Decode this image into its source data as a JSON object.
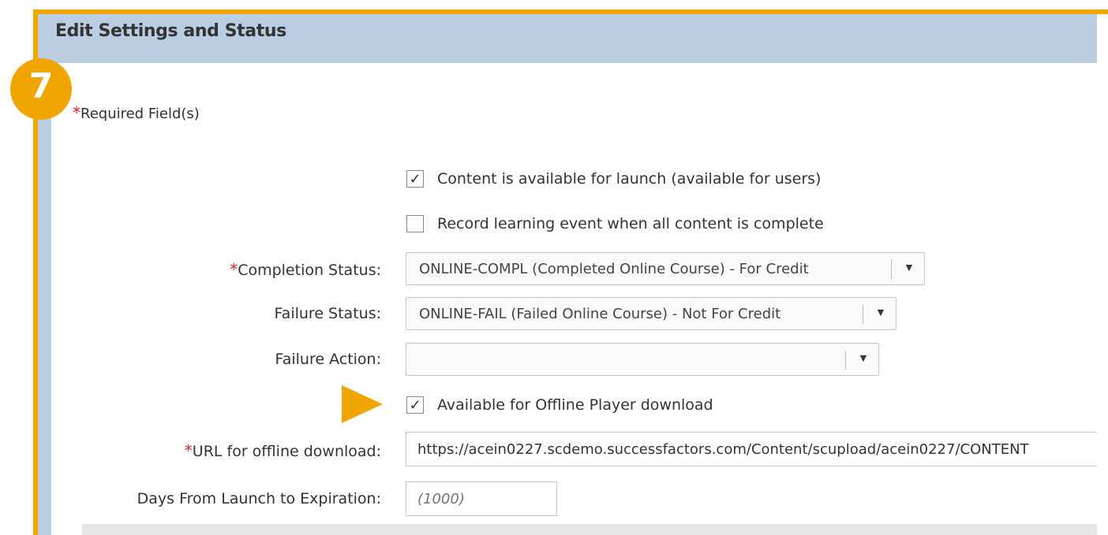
{
  "header": {
    "title": "Edit Settings and Status"
  },
  "step": {
    "number": "7"
  },
  "required_note": {
    "star": "*",
    "text": "Required Field(s)"
  },
  "checkboxes": {
    "content_available": {
      "label": "Content is available for launch (available for users)",
      "checked": true,
      "mark": "✓"
    },
    "record_learning": {
      "label": "Record learning event when all content is complete",
      "checked": false,
      "mark": ""
    },
    "offline_download": {
      "label": "Available for Offline Player download",
      "checked": true,
      "mark": "✓"
    }
  },
  "fields": {
    "completion_status": {
      "star": "*",
      "label": "Completion Status:",
      "value": "ONLINE-COMPL (Completed Online Course) - For Credit",
      "arrow": "▼"
    },
    "failure_status": {
      "label": "Failure Status:",
      "value": "ONLINE-FAIL (Failed Online Course) - Not For Credit",
      "arrow": "▼"
    },
    "failure_action": {
      "label": "Failure Action:",
      "value": "",
      "arrow": "▼"
    },
    "offline_url": {
      "star": "*",
      "label": "URL for offline download:",
      "value": "https://acein0227.scdemo.successfactors.com/Content/scupload/acein0227/CONTENT"
    },
    "days_to_expiration": {
      "label": "Days From Launch to Expiration:",
      "placeholder": "(1000)"
    }
  },
  "colors": {
    "accent": "#f0a500",
    "header_bg": "#b9cde3",
    "required": "#dd2222"
  }
}
